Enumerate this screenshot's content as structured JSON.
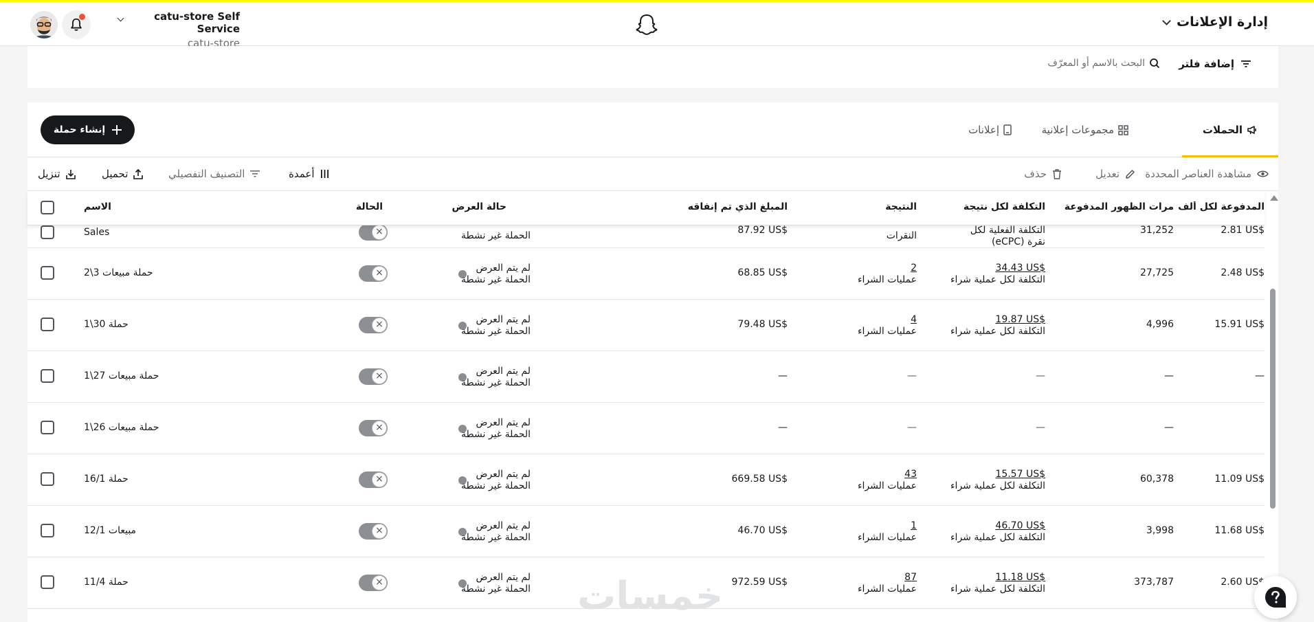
{
  "header": {
    "app_title": "إدارة الإعلانات",
    "account_name": "catu-store Self Service",
    "account_sub": "catu-store"
  },
  "filterbar": {
    "add_filter": "إضافة فلتر",
    "search_placeholder": "البحث بالاسم أو المعرّف"
  },
  "tabs": [
    {
      "label": "الحملات",
      "active": true
    },
    {
      "label": "مجموعات إعلانية",
      "active": false
    },
    {
      "label": "إعلانات",
      "active": false
    }
  ],
  "create_button": "إنشاء حملة",
  "toolbar": {
    "view_selected": "مشاهدة العناصر المحددة",
    "edit": "تعديل",
    "delete": "حذف",
    "columns": "أعمدة",
    "breakdown": "التصنيف التفصيلي",
    "upload": "تحميل",
    "download": "تنزيل"
  },
  "table": {
    "headers": {
      "name": "الاسم",
      "status": "الحالة",
      "delivery": "حالة العرض",
      "spend": "المبلغ الذي تم إنفاقه",
      "result": "النتيجة",
      "cost_per_result": "التكلفة لكل نتيجة",
      "paid_impressions": "مرات الظهور المدفوعة",
      "ecpm": "المدفوعة لكل ألف ظهور"
    },
    "partial_row": {
      "name": "Sales",
      "delivery_line2": "الحملة غير نشطة",
      "spend": "87.92 US$",
      "result_type": "النقرات",
      "cost_line1": "التكلفة الفعلية لكل",
      "cost_line2": "(eCPC) نقرة",
      "impressions": "31,252",
      "ecpm": "2.81 US$"
    },
    "rows": [
      {
        "name": "حملة مبيعات 3\\2",
        "delivery_line1": "لم يتم العرض",
        "delivery_line2": "الحملة غير نشطة",
        "spend": "68.85 US$",
        "result_value": "2",
        "result_type": "عمليات الشراء",
        "cost_value": "34.43 US$",
        "cost_type": "التكلفة لكل عملية شراء",
        "impressions": "27,725",
        "ecpm": "2.48 US$"
      },
      {
        "name": "حملة 30\\1",
        "delivery_line1": "لم يتم العرض",
        "delivery_line2": "الحملة غير نشطة",
        "spend": "79.48 US$",
        "result_value": "4",
        "result_type": "عمليات الشراء",
        "cost_value": "19.87 US$",
        "cost_type": "التكلفة لكل عملية شراء",
        "impressions": "4,996",
        "ecpm": "15.91 US$"
      },
      {
        "name": "حملة مبيعات 27\\1",
        "delivery_line1": "لم يتم العرض",
        "delivery_line2": "الحملة غير نشطة",
        "spend": "—",
        "result_value": "—",
        "result_type": "",
        "cost_value": "—",
        "cost_type": "",
        "impressions": "—",
        "ecpm": "—"
      },
      {
        "name": "حملة مبيعات 26\\1",
        "delivery_line1": "لم يتم العرض",
        "delivery_line2": "الحملة غير نشطة",
        "spend": "—",
        "result_value": "—",
        "result_type": "",
        "cost_value": "—",
        "cost_type": "",
        "impressions": "—",
        "ecpm": ""
      },
      {
        "name": "حملة 16/1",
        "delivery_line1": "لم يتم العرض",
        "delivery_line2": "الحملة غير نشطة",
        "spend": "669.58 US$",
        "result_value": "43",
        "result_type": "عمليات الشراء",
        "cost_value": "15.57 US$",
        "cost_type": "التكلفة لكل عملية شراء",
        "impressions": "60,378",
        "ecpm": "11.09 US$"
      },
      {
        "name": "مبيعات 12/1",
        "delivery_line1": "لم يتم العرض",
        "delivery_line2": "الحملة غير نشطة",
        "spend": "46.70 US$",
        "result_value": "1",
        "result_type": "عمليات الشراء",
        "cost_value": "46.70 US$",
        "cost_type": "التكلفة لكل عملية شراء",
        "impressions": "3,998",
        "ecpm": "11.68 US$"
      },
      {
        "name": "حملة 11/4",
        "delivery_line1": "لم يتم العرض",
        "delivery_line2": "الحملة غير نشطة",
        "spend": "972.59 US$",
        "result_value": "87",
        "result_type": "عمليات الشراء",
        "cost_value": "11.18 US$",
        "cost_type": "التكلفة لكل عملية شراء",
        "impressions": "373,787",
        "ecpm": "2.60 US$"
      }
    ]
  },
  "watermark": "خمسات",
  "colors": {
    "accent": "#f2c200",
    "brand_yellow": "#fffc00",
    "dark": "#16191c"
  }
}
